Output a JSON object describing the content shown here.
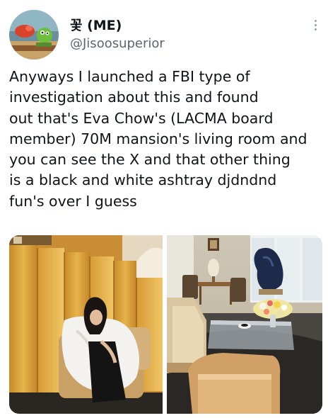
{
  "author": {
    "display_name": "꽃 (ME)",
    "handle": "@Jisoosuperior",
    "avatar_icon": "cartoon-avatar-icon",
    "more_icon": "more-vertical-icon"
  },
  "tweet": {
    "lines": [
      "Anyways I launched a FBI type of",
      "investigation about this and found",
      "out that's Eva Chow's (LACMA board",
      "member) 70M mansion's living room and",
      "you can see the X and that other thing",
      "is a black and white ashtray djdndnd",
      "fun's over I guess"
    ]
  },
  "media": [
    {
      "kind": "photo",
      "subject": "woman-in-white-fur-seated-before-gold-screens"
    },
    {
      "kind": "photo",
      "subject": "living-room-with-dark-sculpture-and-flowers"
    }
  ],
  "colors": {
    "text": "#0f1419",
    "secondary": "#5b6670",
    "background": "#ffffff"
  }
}
